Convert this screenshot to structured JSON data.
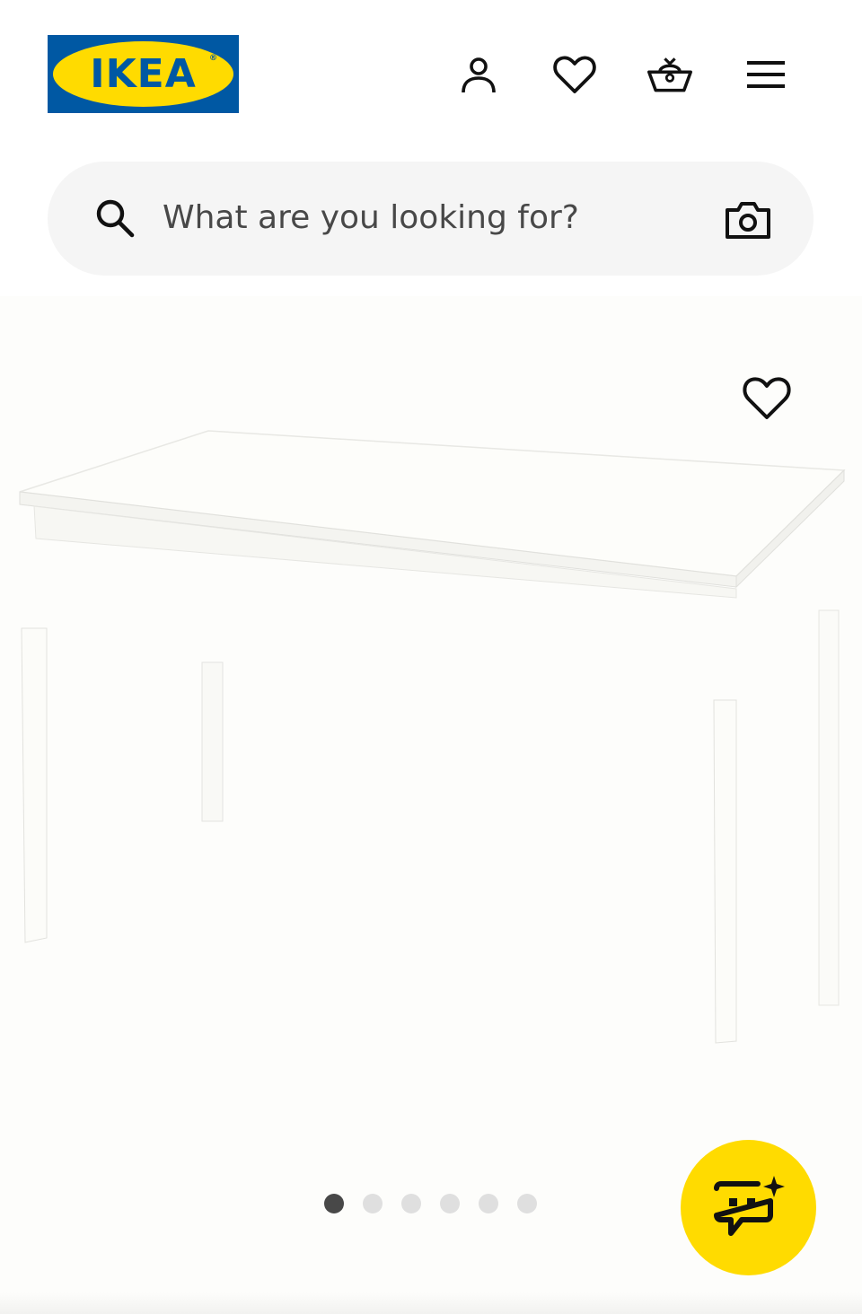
{
  "header": {
    "logo_text": "IKEA",
    "logo_reg": "®",
    "brand_blue": "#0058a3",
    "brand_yellow": "#ffdb00",
    "icons": [
      "user-icon",
      "heart-icon",
      "basket-icon",
      "menu-icon"
    ]
  },
  "search": {
    "placeholder": "What are you looking for?",
    "icon": "search-icon",
    "camera_icon": "camera-icon"
  },
  "product": {
    "image": "white rectangular dining table",
    "favourite_icon": "heart-icon",
    "carousel": {
      "total": 6,
      "active": 1
    }
  },
  "assistant": {
    "icon": "chat-sparkle-icon",
    "color": "#ffdb00"
  }
}
